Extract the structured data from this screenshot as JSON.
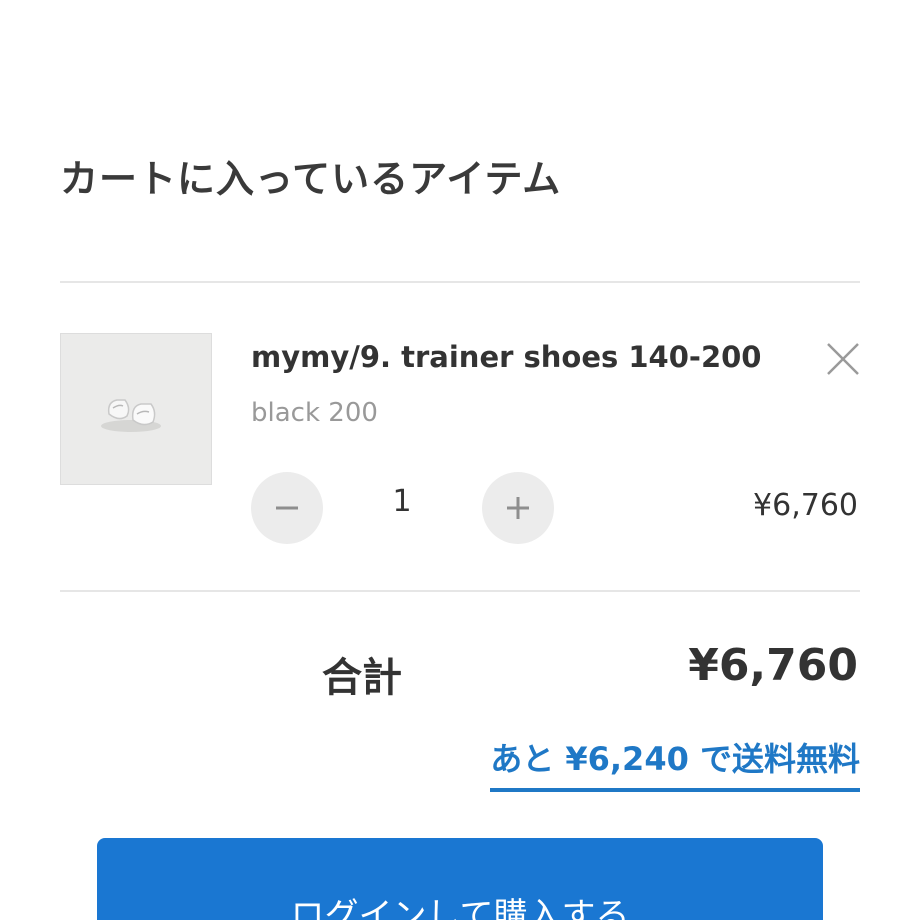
{
  "cart": {
    "title": "カートに入っているアイテム",
    "item": {
      "name": "mymy/9. trainer shoes 140-200",
      "variant": "black 200",
      "quantity": "1",
      "price": "¥6,760",
      "image_icon": "shoe-thumbnail",
      "remove_icon": "close-icon",
      "minus_icon": "minus-icon",
      "plus_icon": "plus-icon"
    },
    "total_label": "合計",
    "total_value": "¥6,760",
    "shipping_note": "あと ¥6,240 で送料無料",
    "checkout_label": "ログインして購入する"
  },
  "colors": {
    "accent": "#1a77d2",
    "link": "#1f78c6",
    "text": "#333333",
    "muted": "#999999",
    "divider": "#e6e6e6"
  }
}
